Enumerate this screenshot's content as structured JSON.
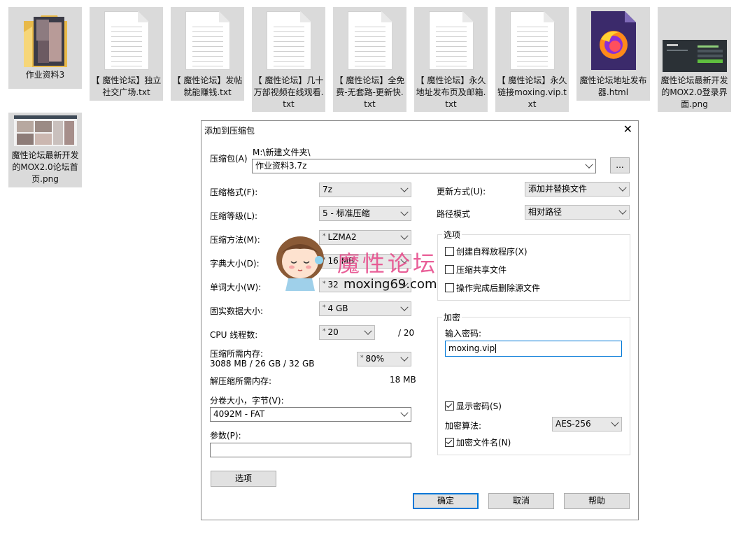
{
  "desktop": {
    "files": [
      {
        "name": "作业资料3",
        "type": "folder"
      },
      {
        "name": "【 魔性论坛】独立社交广场.txt",
        "type": "txt"
      },
      {
        "name": "【 魔性论坛】发帖就能赚钱.txt",
        "type": "txt"
      },
      {
        "name": "【 魔性论坛】几十万部视频在线观看.txt",
        "type": "txt"
      },
      {
        "name": "【 魔性论坛】全免费-无套路-更新快.txt",
        "type": "txt"
      },
      {
        "name": "【 魔性论坛】永久地址发布页及邮箱.txt",
        "type": "txt"
      },
      {
        "name": "【 魔性论坛】永久链接moxing.vip.txt",
        "type": "txt"
      },
      {
        "name": "魔性论坛地址发布器.html",
        "type": "html"
      },
      {
        "name": "魔性论坛最新开发的MOX2.0登录界面.png",
        "type": "png"
      },
      {
        "name": "魔性论坛最新开发的MOX2.0论坛首页.png",
        "type": "png"
      }
    ]
  },
  "dialog": {
    "title": "添加到压缩包",
    "close_icon": "close-icon",
    "archive_label": "压缩包(A)",
    "archive_path": "M:\\新建文件夹\\",
    "archive_name": "作业资料3.7z",
    "browse_label": "...",
    "format_label": "压缩格式(F):",
    "format_value": "7z",
    "level_label": "压缩等级(L):",
    "level_value": "5 - 标准压缩",
    "method_label": "压缩方法(M):",
    "method_value": "LZMA2",
    "dict_label": "字典大小(D):",
    "dict_value": "16 MB",
    "word_label": "单词大小(W):",
    "word_value": "32",
    "solid_label": "固实数据大小:",
    "solid_value": "4 GB",
    "threads_label": "CPU 线程数:",
    "threads_value": "20",
    "threads_total": "/ 20",
    "mem_label": "压缩所需内存:",
    "mem_detail": "3088 MB / 26 GB / 32 GB",
    "mem_value": "80%",
    "decomp_label": "解压缩所需内存:",
    "decomp_value": "18 MB",
    "volume_label": "分卷大小，字节(V):",
    "volume_value": "4092M - FAT",
    "params_label": "参数(P):",
    "params_value": "",
    "options_button": "选项",
    "update_label": "更新方式(U):",
    "update_value": "添加并替换文件",
    "pathmode_label": "路径模式",
    "pathmode_value": "相对路径",
    "options_group": {
      "title": "选项",
      "sfx": "创建自释放程序(X)",
      "shared": "压缩共享文件",
      "delete_after": "操作完成后删除源文件"
    },
    "encrypt_group": {
      "title": "加密",
      "password_label": "输入密码:",
      "password_value": "moxing.vip",
      "show_password": "显示密码(S)",
      "method_label": "加密算法:",
      "method_value": "AES-256",
      "encrypt_names": "加密文件名(N)"
    },
    "ok_button": "确定",
    "cancel_button": "取消",
    "help_button": "帮助"
  },
  "watermark": {
    "text": "魔性论坛",
    "url": "moxing69.com"
  },
  "colors": {
    "file_bg": "#dadada",
    "focus_blue": "#0078d7",
    "watermark_pink": "#e64a8a"
  }
}
